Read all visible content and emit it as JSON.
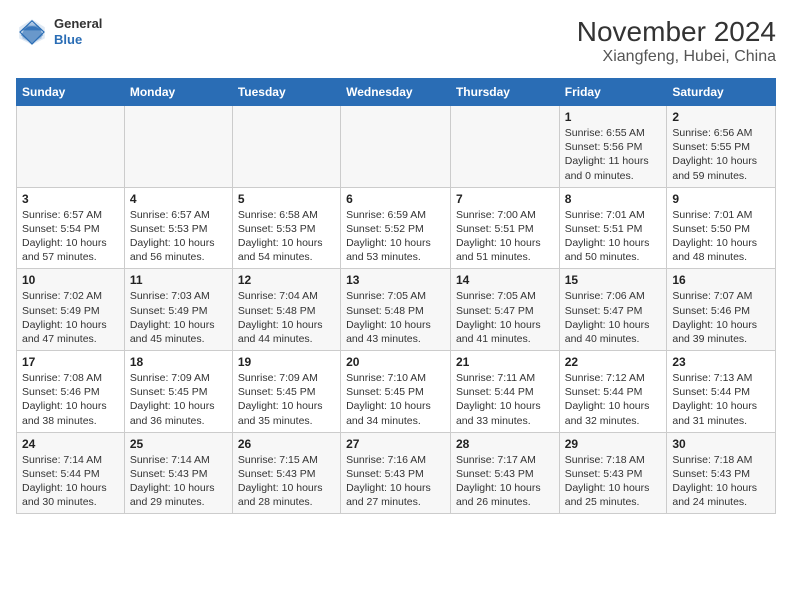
{
  "header": {
    "logo": {
      "general": "General",
      "blue": "Blue"
    },
    "title": "November 2024",
    "subtitle": "Xiangfeng, Hubei, China"
  },
  "weekdays": [
    "Sunday",
    "Monday",
    "Tuesday",
    "Wednesday",
    "Thursday",
    "Friday",
    "Saturday"
  ],
  "weeks": [
    [
      {
        "day": "",
        "info": ""
      },
      {
        "day": "",
        "info": ""
      },
      {
        "day": "",
        "info": ""
      },
      {
        "day": "",
        "info": ""
      },
      {
        "day": "",
        "info": ""
      },
      {
        "day": "1",
        "info": "Sunrise: 6:55 AM\nSunset: 5:56 PM\nDaylight: 11 hours and 0 minutes."
      },
      {
        "day": "2",
        "info": "Sunrise: 6:56 AM\nSunset: 5:55 PM\nDaylight: 10 hours and 59 minutes."
      }
    ],
    [
      {
        "day": "3",
        "info": "Sunrise: 6:57 AM\nSunset: 5:54 PM\nDaylight: 10 hours and 57 minutes."
      },
      {
        "day": "4",
        "info": "Sunrise: 6:57 AM\nSunset: 5:53 PM\nDaylight: 10 hours and 56 minutes."
      },
      {
        "day": "5",
        "info": "Sunrise: 6:58 AM\nSunset: 5:53 PM\nDaylight: 10 hours and 54 minutes."
      },
      {
        "day": "6",
        "info": "Sunrise: 6:59 AM\nSunset: 5:52 PM\nDaylight: 10 hours and 53 minutes."
      },
      {
        "day": "7",
        "info": "Sunrise: 7:00 AM\nSunset: 5:51 PM\nDaylight: 10 hours and 51 minutes."
      },
      {
        "day": "8",
        "info": "Sunrise: 7:01 AM\nSunset: 5:51 PM\nDaylight: 10 hours and 50 minutes."
      },
      {
        "day": "9",
        "info": "Sunrise: 7:01 AM\nSunset: 5:50 PM\nDaylight: 10 hours and 48 minutes."
      }
    ],
    [
      {
        "day": "10",
        "info": "Sunrise: 7:02 AM\nSunset: 5:49 PM\nDaylight: 10 hours and 47 minutes."
      },
      {
        "day": "11",
        "info": "Sunrise: 7:03 AM\nSunset: 5:49 PM\nDaylight: 10 hours and 45 minutes."
      },
      {
        "day": "12",
        "info": "Sunrise: 7:04 AM\nSunset: 5:48 PM\nDaylight: 10 hours and 44 minutes."
      },
      {
        "day": "13",
        "info": "Sunrise: 7:05 AM\nSunset: 5:48 PM\nDaylight: 10 hours and 43 minutes."
      },
      {
        "day": "14",
        "info": "Sunrise: 7:05 AM\nSunset: 5:47 PM\nDaylight: 10 hours and 41 minutes."
      },
      {
        "day": "15",
        "info": "Sunrise: 7:06 AM\nSunset: 5:47 PM\nDaylight: 10 hours and 40 minutes."
      },
      {
        "day": "16",
        "info": "Sunrise: 7:07 AM\nSunset: 5:46 PM\nDaylight: 10 hours and 39 minutes."
      }
    ],
    [
      {
        "day": "17",
        "info": "Sunrise: 7:08 AM\nSunset: 5:46 PM\nDaylight: 10 hours and 38 minutes."
      },
      {
        "day": "18",
        "info": "Sunrise: 7:09 AM\nSunset: 5:45 PM\nDaylight: 10 hours and 36 minutes."
      },
      {
        "day": "19",
        "info": "Sunrise: 7:09 AM\nSunset: 5:45 PM\nDaylight: 10 hours and 35 minutes."
      },
      {
        "day": "20",
        "info": "Sunrise: 7:10 AM\nSunset: 5:45 PM\nDaylight: 10 hours and 34 minutes."
      },
      {
        "day": "21",
        "info": "Sunrise: 7:11 AM\nSunset: 5:44 PM\nDaylight: 10 hours and 33 minutes."
      },
      {
        "day": "22",
        "info": "Sunrise: 7:12 AM\nSunset: 5:44 PM\nDaylight: 10 hours and 32 minutes."
      },
      {
        "day": "23",
        "info": "Sunrise: 7:13 AM\nSunset: 5:44 PM\nDaylight: 10 hours and 31 minutes."
      }
    ],
    [
      {
        "day": "24",
        "info": "Sunrise: 7:14 AM\nSunset: 5:44 PM\nDaylight: 10 hours and 30 minutes."
      },
      {
        "day": "25",
        "info": "Sunrise: 7:14 AM\nSunset: 5:43 PM\nDaylight: 10 hours and 29 minutes."
      },
      {
        "day": "26",
        "info": "Sunrise: 7:15 AM\nSunset: 5:43 PM\nDaylight: 10 hours and 28 minutes."
      },
      {
        "day": "27",
        "info": "Sunrise: 7:16 AM\nSunset: 5:43 PM\nDaylight: 10 hours and 27 minutes."
      },
      {
        "day": "28",
        "info": "Sunrise: 7:17 AM\nSunset: 5:43 PM\nDaylight: 10 hours and 26 minutes."
      },
      {
        "day": "29",
        "info": "Sunrise: 7:18 AM\nSunset: 5:43 PM\nDaylight: 10 hours and 25 minutes."
      },
      {
        "day": "30",
        "info": "Sunrise: 7:18 AM\nSunset: 5:43 PM\nDaylight: 10 hours and 24 minutes."
      }
    ]
  ]
}
